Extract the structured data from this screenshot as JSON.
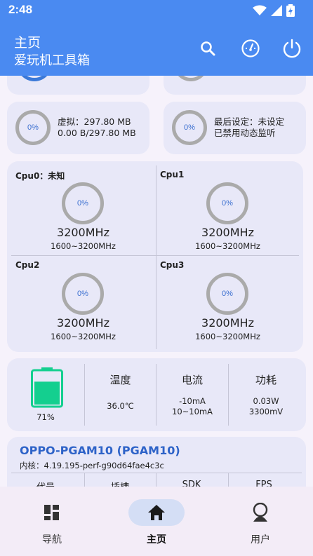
{
  "status": {
    "time": "2:48"
  },
  "appbar": {
    "title": "主页",
    "subtitle": "爱玩机工具箱",
    "actions": [
      "search-icon",
      "speedometer-icon",
      "power-icon"
    ]
  },
  "stats": {
    "swap": {
      "percent": "0%",
      "line1": "虚拟：297.80 MB",
      "line2": "0.00 B/297.80 MB"
    },
    "monitor": {
      "percent": "0%",
      "line1": "最后设定：未设定",
      "line2": "已禁用动态监听"
    }
  },
  "cpu": [
    {
      "label": "Cpu0：未知",
      "percent": "0%",
      "freq": "3200MHz",
      "range": "1600~3200MHz"
    },
    {
      "label": "Cpu1",
      "percent": "0%",
      "freq": "3200MHz",
      "range": "1600~3200MHz"
    },
    {
      "label": "Cpu2",
      "percent": "0%",
      "freq": "3200MHz",
      "range": "1600~3200MHz"
    },
    {
      "label": "Cpu3",
      "percent": "0%",
      "freq": "3200MHz",
      "range": "1600~3200MHz"
    }
  ],
  "battery": {
    "level": "71%",
    "level_value": 0.71,
    "temp_title": "温度",
    "temp_value": "36.0℃",
    "current_title": "电流",
    "current_value": "-10mA",
    "current_range": "10~10mA",
    "power_title": "功耗",
    "power_value": "0.03W",
    "voltage_value": "3300mV"
  },
  "device": {
    "name": "OPPO-PGAM10  (PGAM10)",
    "kernel": "内核：4.19.195-perf-g90d64fae4c3c",
    "cols": [
      "代号",
      "插槽",
      "SDK",
      "FPS"
    ]
  },
  "nav": [
    {
      "label": "导航",
      "icon": "dashboard-icon"
    },
    {
      "label": "主页",
      "icon": "home-icon"
    },
    {
      "label": "用户",
      "icon": "user-icon"
    }
  ],
  "colors": {
    "primary": "#4a8af1",
    "battery": "#14cf8f",
    "accent": "#2e63c8"
  }
}
